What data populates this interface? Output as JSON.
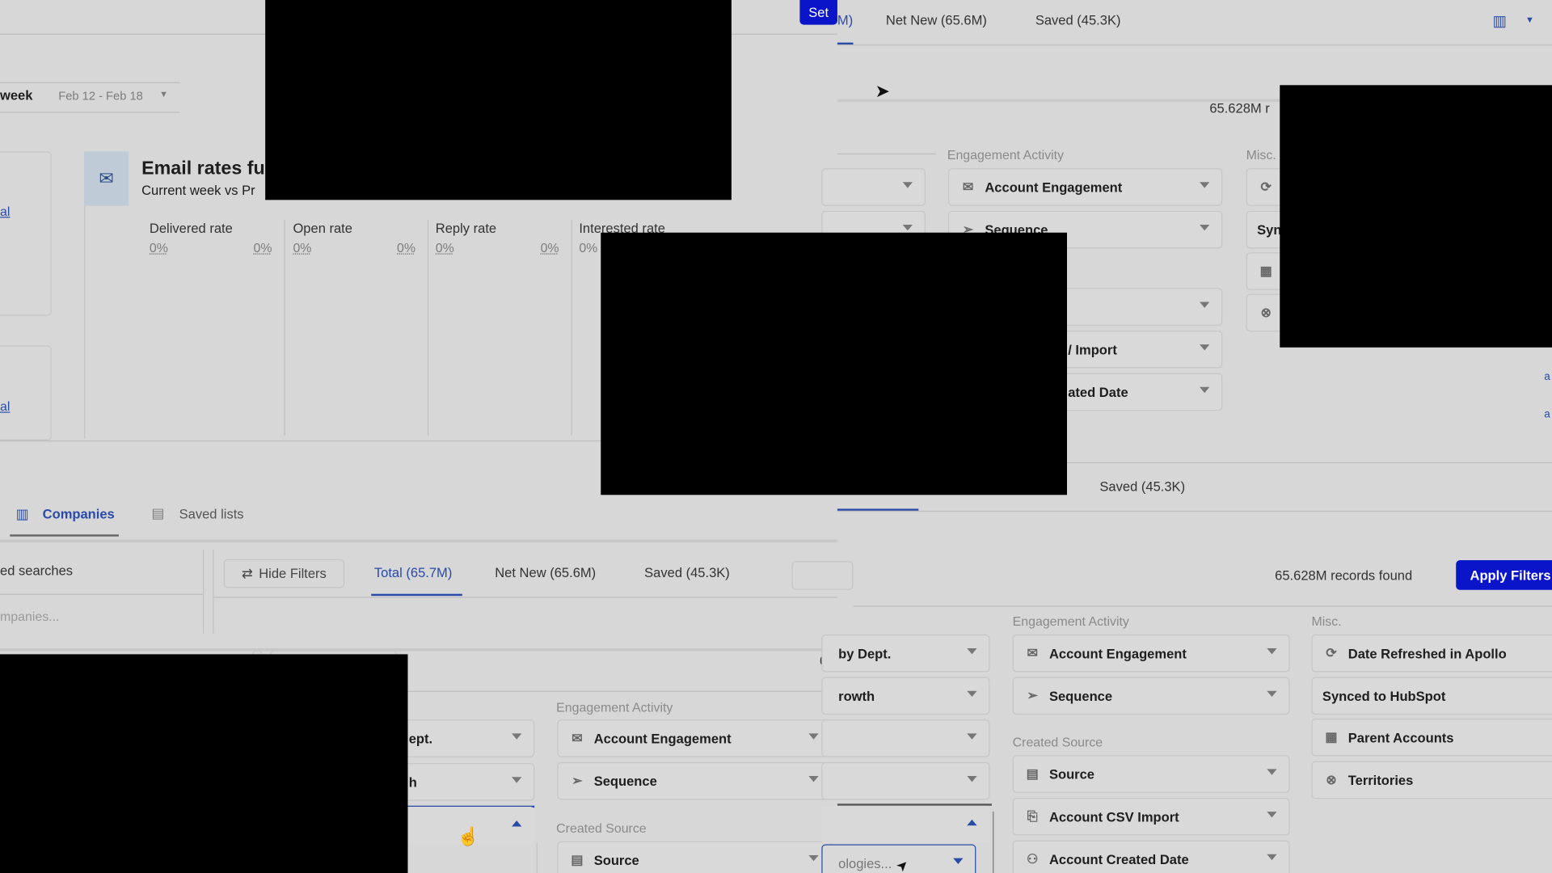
{
  "top_bar": {
    "set_button": "Set",
    "tabs": [
      "M)",
      "Net New (65.6M)",
      "Saved (45.3K)"
    ],
    "org_icon": "building-icon"
  },
  "date_filter": {
    "period": "week",
    "range": "Feb 12 - Feb 18"
  },
  "left_cards": {
    "link_1": "al",
    "link_2": "al"
  },
  "email_card": {
    "title": "Email rates fu",
    "subtitle": "Current week vs Pr",
    "metrics": [
      {
        "label": "Delivered rate",
        "current": "0%",
        "previous": "0%"
      },
      {
        "label": "Open rate",
        "current": "0%",
        "previous": "0%"
      },
      {
        "label": "Reply rate",
        "current": "0%",
        "previous": "0%"
      },
      {
        "label": "Interested rate",
        "current": "0%"
      }
    ]
  },
  "upper_filters": {
    "records": "65.628M r",
    "engagement_title": "Engagement Activity",
    "misc_title": "Misc.",
    "items": [
      "Account Engagement",
      "Sequence",
      "/ Import",
      "ated Date"
    ],
    "misc_items": [
      "Syn"
    ],
    "saved_tab": "Saved (45.3K)"
  },
  "nav_tabs": [
    {
      "label": "Companies",
      "active": true
    },
    {
      "label": "Saved lists",
      "active": false
    }
  ],
  "saved_searches": {
    "title": "ed searches",
    "placeholder": "mpanies..."
  },
  "results_bar": {
    "hide_filters": "Hide Filters",
    "tabs": [
      "Total (65.7M)",
      "Net New (65.6M)",
      "Saved (45.3K)"
    ],
    "records_partial": "65",
    "records_found": "65.628M records found",
    "apply_filters": "Apply Filters"
  },
  "mid_filters": {
    "engagement_title": "Engagement Activity",
    "created_source_title": "Created Source",
    "left_items": [
      "ept.",
      "h"
    ],
    "items": [
      "Account Engagement",
      "Sequence",
      "Source"
    ]
  },
  "right_filters": {
    "left_items": [
      "by Dept.",
      "rowth",
      "ologies..."
    ],
    "engagement_title": "Engagement Activity",
    "engagement_items": [
      "Account Engagement",
      "Sequence"
    ],
    "created_source_title": "Created Source",
    "created_items": [
      "Source",
      "Account CSV Import",
      "Account Created Date"
    ],
    "misc_title": "Misc.",
    "misc_items": [
      "Date Refreshed in Apollo",
      "Synced to HubSpot",
      "Parent Accounts",
      "Territories"
    ]
  },
  "colors": {
    "accent": "#2a4aa8",
    "primary_button": "#0a14c8",
    "background": "#d7d7d7"
  }
}
